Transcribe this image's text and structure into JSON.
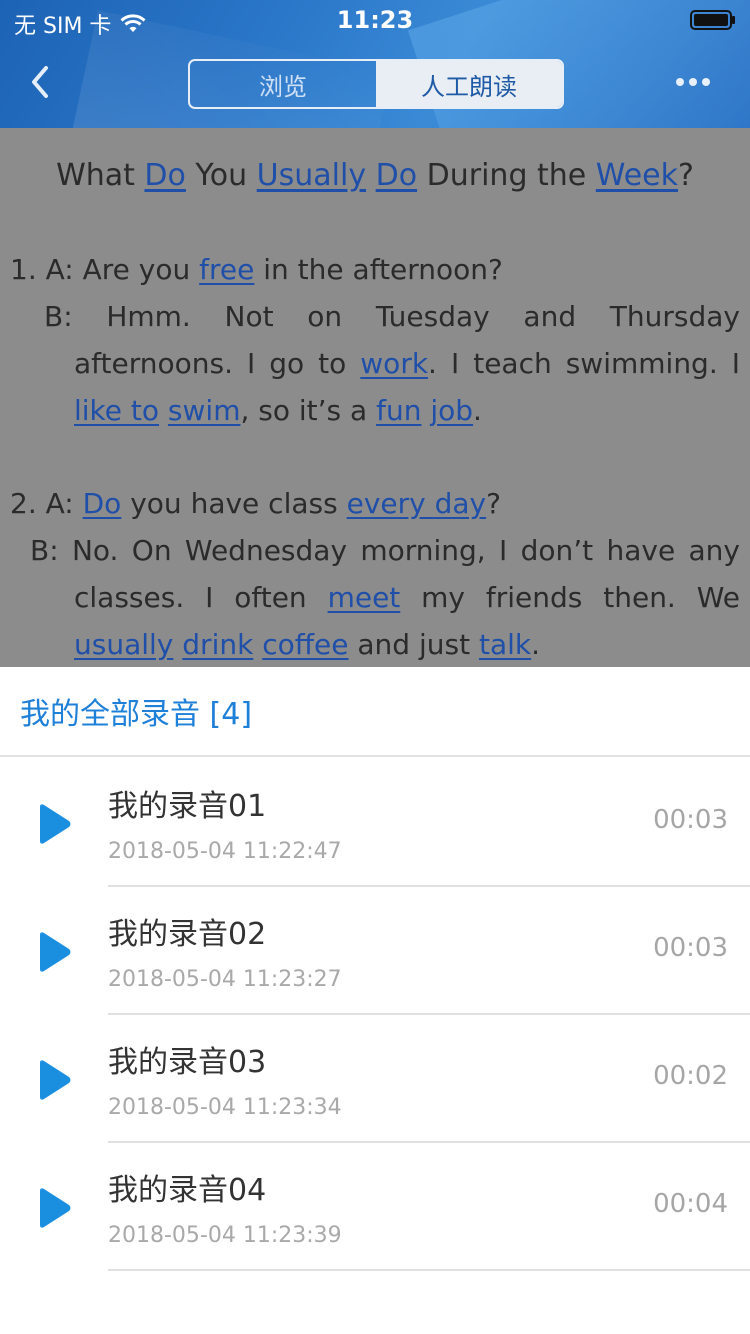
{
  "status_bar": {
    "carrier": "无 SIM 卡",
    "time": "11:23"
  },
  "nav": {
    "tabs": [
      "浏览",
      "人工朗读"
    ],
    "active_tab": "人工朗读"
  },
  "lesson": {
    "title_parts": [
      {
        "t": "What "
      },
      {
        "t": "Do",
        "link": true
      },
      {
        "t": " You "
      },
      {
        "t": "Usually",
        "link": true
      },
      {
        "t": " "
      },
      {
        "t": "Do",
        "link": true
      },
      {
        "t": " During the "
      },
      {
        "t": "Week",
        "link": true
      },
      {
        "t": "?"
      }
    ],
    "p1_line1": [
      {
        "t": "1. A: Are you "
      },
      {
        "t": "free",
        "link": true
      },
      {
        "t": " in the afternoon?"
      }
    ],
    "p1_line2": [
      {
        "t": "B: Hmm. Not on Tuesday and Thursday"
      }
    ],
    "p1_line3": [
      {
        "t": "afternoons. I go to "
      },
      {
        "t": "work",
        "link": true
      },
      {
        "t": ". I teach swimming. I"
      }
    ],
    "p1_line4": [
      {
        "t": "like to",
        "link": true
      },
      {
        "t": " "
      },
      {
        "t": "swim",
        "link": true
      },
      {
        "t": ", so it’s a "
      },
      {
        "t": "fun",
        "link": true
      },
      {
        "t": " "
      },
      {
        "t": "job",
        "link": true
      },
      {
        "t": "."
      }
    ],
    "p2_line1": [
      {
        "t": "2. A: "
      },
      {
        "t": "Do",
        "link": true
      },
      {
        "t": " you have class "
      },
      {
        "t": "every day",
        "link": true
      },
      {
        "t": "?"
      }
    ],
    "p2_line2": [
      {
        "t": "B: No. On Wednesday morning, I don’t have any"
      }
    ],
    "p2_line3": [
      {
        "t": "classes. I often "
      },
      {
        "t": "meet",
        "link": true
      },
      {
        "t": " my friends then. We"
      }
    ],
    "p2_line4": [
      {
        "t": "usually",
        "link": true
      },
      {
        "t": " "
      },
      {
        "t": "drink",
        "link": true
      },
      {
        "t": " "
      },
      {
        "t": "coffee",
        "link": true
      },
      {
        "t": " and just "
      },
      {
        "t": "talk",
        "link": true
      },
      {
        "t": "."
      }
    ]
  },
  "recordings": {
    "header": "我的全部录音 [4]",
    "items": [
      {
        "name": "我的录音01",
        "date": "2018-05-04 11:22:47",
        "duration": "00:03"
      },
      {
        "name": "我的录音02",
        "date": "2018-05-04 11:23:27",
        "duration": "00:03"
      },
      {
        "name": "我的录音03",
        "date": "2018-05-04 11:23:34",
        "duration": "00:02"
      },
      {
        "name": "我的录音04",
        "date": "2018-05-04 11:23:39",
        "duration": "00:04"
      }
    ]
  },
  "colors": {
    "accent": "#1e80d8",
    "link": "#1f4fa8",
    "play": "#1a8fe0"
  },
  "icons": {
    "back": "chevron-left-icon",
    "more": "more-dots-icon",
    "play": "play-icon",
    "wifi": "wifi-icon",
    "battery": "battery-icon"
  }
}
